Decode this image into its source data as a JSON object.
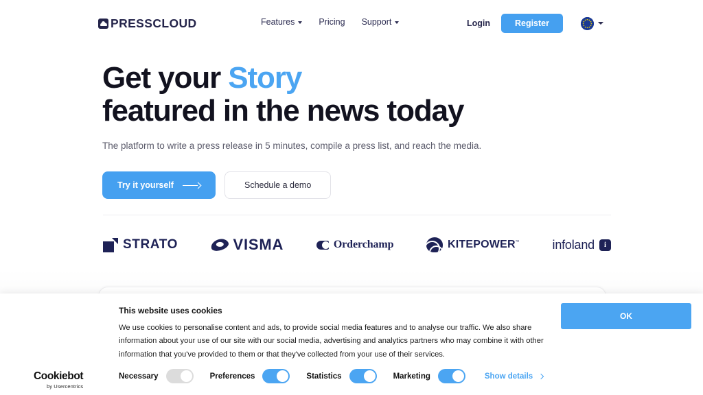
{
  "header": {
    "logo_text": "PRESSCLOUD",
    "logo_icon": "cloud-icon",
    "nav": [
      {
        "label": "Features",
        "has_dropdown": true
      },
      {
        "label": "Pricing",
        "has_dropdown": false
      },
      {
        "label": "Support",
        "has_dropdown": true
      }
    ],
    "login_label": "Login",
    "register_label": "Register",
    "language_icon": "eu-flag-icon"
  },
  "hero": {
    "headline_part1": "Get your ",
    "headline_accent": "Story",
    "headline_line2": "featured in the news today",
    "subhead": "The platform to write a press release in 5 minutes, compile a press list, and reach the media.",
    "primary_cta": "Try it yourself",
    "secondary_cta": "Schedule a demo"
  },
  "clients": [
    {
      "name": "STRATO",
      "icon": "strato-logo"
    },
    {
      "name": "VISMA",
      "icon": "visma-logo"
    },
    {
      "name": "Orderchamp",
      "icon": "orderchamp-logo"
    },
    {
      "name": "KITEPOWER",
      "tm": "™",
      "icon": "kitepower-logo"
    },
    {
      "name": "infoland",
      "badge": "i",
      "icon": "infoland-logo"
    }
  ],
  "cookie_banner": {
    "title": "This website uses cookies",
    "paragraph": "We use cookies to personalise content and ads, to provide social media features and to analyse our traffic. We also share information about your use of our site with our social media, advertising and analytics partners who may combine it with other information that you've provided to them or that they've collected from your use of their services.",
    "ok_label": "OK",
    "brand": "Cookiebot",
    "brand_sub": "by Usercentrics",
    "show_details": "Show details",
    "toggles": [
      {
        "label": "Necessary",
        "state": "off-locked"
      },
      {
        "label": "Preferences",
        "state": "on"
      },
      {
        "label": "Statistics",
        "state": "on"
      },
      {
        "label": "Marketing",
        "state": "on"
      }
    ]
  },
  "colors": {
    "accent_blue": "#45a0f0",
    "headline_dark": "#12121f",
    "brand_navy": "#1e2256"
  }
}
